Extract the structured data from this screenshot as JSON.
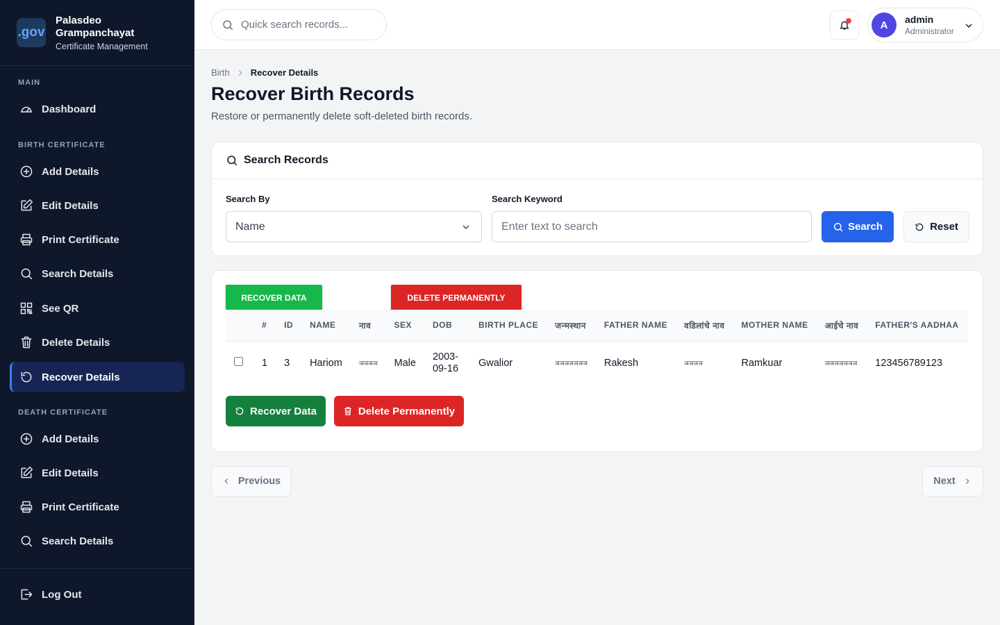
{
  "brand": {
    "logo": ".gov",
    "name_line1": "Palasdeo",
    "name_line2": "Grampanchayat",
    "subtitle": "Certificate Management"
  },
  "sidebar": {
    "main_label": "MAIN",
    "dashboard": "Dashboard",
    "birth_label": "BIRTH CERTIFICATE",
    "birth_items": [
      "Add Details",
      "Edit Details",
      "Print Certificate",
      "Search Details",
      "See QR",
      "Delete Details",
      "Recover Details"
    ],
    "death_label": "DEATH CERTIFICATE",
    "death_items": [
      "Add Details",
      "Edit Details",
      "Print Certificate",
      "Search Details"
    ],
    "logout": "Log Out",
    "active_item": "Recover Details"
  },
  "topbar": {
    "search_placeholder": "Quick search records...",
    "user_initial": "A",
    "user_name": "admin",
    "user_role": "Administrator"
  },
  "breadcrumb": {
    "parent": "Birth",
    "current": "Recover Details"
  },
  "page": {
    "title": "Recover Birth Records",
    "description": "Restore or permanently delete soft-deleted birth records."
  },
  "search_card": {
    "title": "Search Records",
    "search_by_label": "Search By",
    "search_by_value": "Name",
    "keyword_label": "Search Keyword",
    "keyword_placeholder": "Enter text to search",
    "search_button": "Search",
    "reset_button": "Reset"
  },
  "results": {
    "recover_top_button": "RECOVER DATA",
    "delete_top_button": "DELETE PERMANENTLY",
    "columns": [
      "#",
      "ID",
      "NAME",
      "नाव",
      "SEX",
      "DOB",
      "BIRTH PLACE",
      "जन्मस्थान",
      "FATHER NAME",
      "वडिलांचे नाव",
      "MOTHER NAME",
      "आईचे नाव",
      "FATHER'S AADHAA"
    ],
    "rows": [
      {
        "index": "1",
        "id": "3",
        "name": "Hariom",
        "name_mr": "ञञञञ",
        "sex": "Male",
        "dob": "2003-09-16",
        "birth_place": "Gwalior",
        "birth_place_mr": "ञञञञञञञ",
        "father_name": "Rakesh",
        "father_name_mr": "ञञञञ",
        "mother_name": "Ramkuar",
        "mother_name_mr": "ञञञञञञञ",
        "father_aadhaar": "123456789123"
      }
    ],
    "recover_button": "Recover Data",
    "delete_button": "Delete Permanently"
  },
  "pagination": {
    "previous": "Previous",
    "next": "Next"
  },
  "colors": {
    "sidebar_bg": "#0f172a",
    "primary": "#2563eb",
    "success": "#15803d",
    "danger": "#dc2626"
  }
}
